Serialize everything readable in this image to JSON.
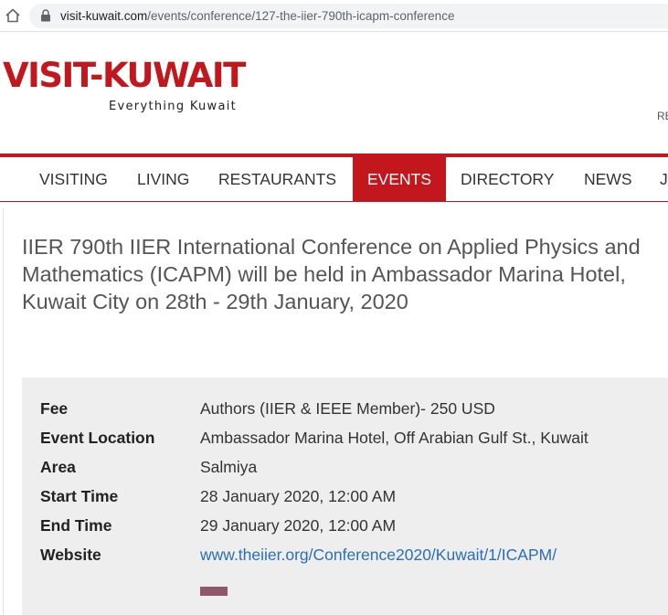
{
  "browser": {
    "url_host": "visit-kuwait.com",
    "url_path": "/events/conference/127-the-iier-790th-icapm-conference",
    "icons": [
      "home-icon",
      "lock-icon"
    ]
  },
  "header": {
    "logo_text": "VISIT-KUWAIT",
    "tagline": "Everything Kuwait",
    "right_link_fragment": "RE",
    "brand_color": "#c2171d"
  },
  "nav": {
    "items": [
      "VISITING",
      "LIVING",
      "RESTAURANTS",
      "EVENTS",
      "DIRECTORY",
      "NEWS",
      "J"
    ],
    "active": "EVENTS"
  },
  "event": {
    "title": "IIER 790th IIER International Conference on Applied Physics and Mathematics (ICAPM) will be held in Ambassador Marina Hotel, Kuwait City on 28th - 29th January, 2020",
    "details": [
      {
        "label": "Fee",
        "value": "Authors (IIER & IEEE Member)- 250 USD"
      },
      {
        "label": "Event Location",
        "value": "Ambassador Marina Hotel, Off Arabian Gulf St., Kuwait"
      },
      {
        "label": "Area",
        "value": "Salmiya"
      },
      {
        "label": "Start Time",
        "value": "28 January 2020, 12:00 AM"
      },
      {
        "label": "End Time",
        "value": "29 January 2020, 12:00 AM"
      },
      {
        "label": "Website",
        "value": "www.theiier.org/Conference2020/Kuwait/1/ICAPM/"
      }
    ],
    "link_color": "#2a6ebb"
  }
}
